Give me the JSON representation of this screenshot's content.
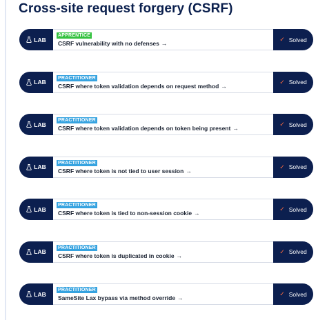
{
  "page": {
    "title": "Cross-site request forgery (CSRF)"
  },
  "labs": [
    {
      "badge": "LAB",
      "level": "APPRENTICE",
      "level_type": "apprentice",
      "title": "CSRF vulnerability with no defenses",
      "status": "Solved"
    },
    {
      "badge": "LAB",
      "level": "PRACTITIONER",
      "level_type": "practitioner",
      "title": "CSRF where token validation depends on request method",
      "status": "Solved"
    },
    {
      "badge": "LAB",
      "level": "PRACTITIONER",
      "level_type": "practitioner",
      "title": "CSRF where token validation depends on token being present",
      "status": "Solved"
    },
    {
      "badge": "LAB",
      "level": "PRACTITIONER",
      "level_type": "practitioner",
      "title": "CSRF where token is not tied to user session",
      "status": "Solved"
    },
    {
      "badge": "LAB",
      "level": "PRACTITIONER",
      "level_type": "practitioner",
      "title": "CSRF where token is tied to non-session cookie",
      "status": "Solved"
    },
    {
      "badge": "LAB",
      "level": "PRACTITIONER",
      "level_type": "practitioner",
      "title": "CSRF where token is duplicated in cookie",
      "status": "Solved"
    },
    {
      "badge": "LAB",
      "level": "PRACTITIONER",
      "level_type": "practitioner",
      "title": "SameSite Lax bypass via method override",
      "status": "Solved"
    }
  ],
  "icons": {
    "lab": "flask-icon",
    "link": "arrow-right-icon",
    "solved": "check-icon"
  },
  "colors": {
    "navy": "#0c1f4f",
    "apprentice": "#35c240",
    "practitioner": "#36a3e0",
    "check": "#ff6a3d"
  }
}
